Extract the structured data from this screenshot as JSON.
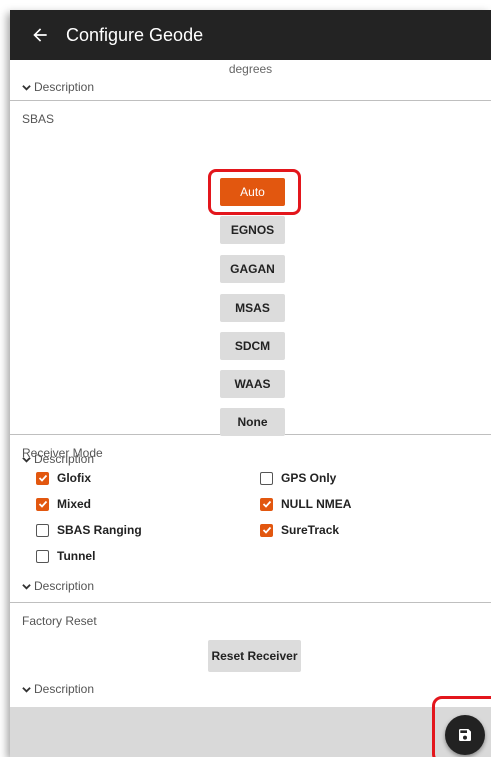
{
  "header": {
    "title": "Configure Geode"
  },
  "sections": {
    "top": {
      "unit_text": "degrees",
      "description_label": "Description"
    },
    "sbas": {
      "title": "SBAS",
      "options": [
        "Auto",
        "EGNOS",
        "GAGAN",
        "MSAS",
        "SDCM",
        "WAAS",
        "None"
      ],
      "selected": "Auto",
      "description_label": "Description"
    },
    "receiver_mode": {
      "title": "Receiver Mode",
      "checkboxes": [
        {
          "label": "Glofix",
          "checked": true
        },
        {
          "label": "GPS Only",
          "checked": false
        },
        {
          "label": "Mixed",
          "checked": true
        },
        {
          "label": "NULL NMEA",
          "checked": true
        },
        {
          "label": "SBAS Ranging",
          "checked": false
        },
        {
          "label": "SureTrack",
          "checked": true
        },
        {
          "label": "Tunnel",
          "checked": false
        }
      ],
      "description_label": "Description"
    },
    "factory_reset": {
      "title": "Factory Reset",
      "button_label": "Reset Receiver",
      "description_label": "Description"
    }
  },
  "colors": {
    "accent": "#e2570f",
    "highlight": "#e3161c",
    "appbar": "#232323"
  },
  "icons": {
    "back": "arrow-left-icon",
    "save": "floppy-disk-icon"
  }
}
